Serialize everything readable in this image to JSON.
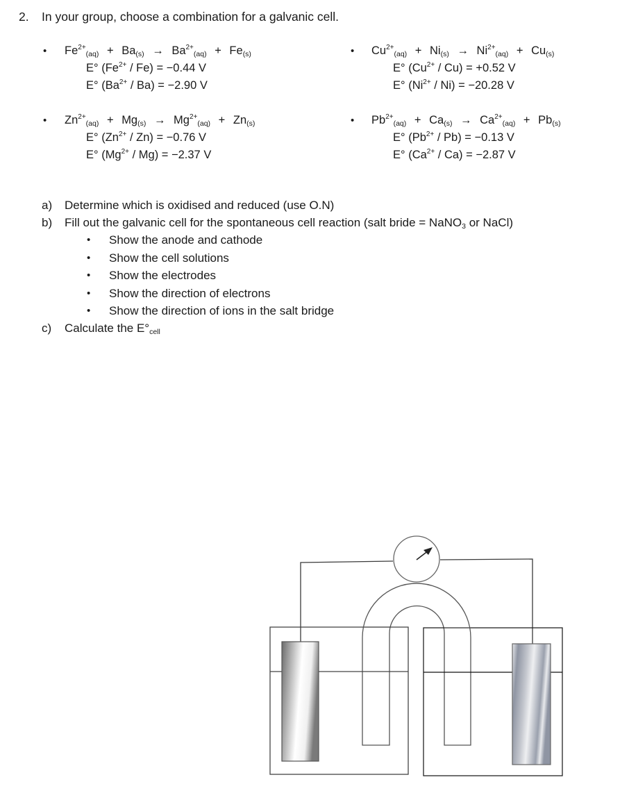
{
  "question": {
    "number": "2.",
    "prompt": "In your group, choose a combination for a galvanic cell."
  },
  "combinations": [
    {
      "reaction": {
        "r1": "Fe",
        "r1_charge": "2+",
        "r1_state": "(aq)",
        "r2": "Ba",
        "r2_state": "(s)",
        "p1": "Ba",
        "p1_charge": "2+",
        "p1_state": "(aq)",
        "p2": "Fe",
        "p2_state": "(s)",
        "plus": "+",
        "arrow": "→"
      },
      "potentials": [
        {
          "prefix": "E° (",
          "ion": "Fe",
          "charge": "2+",
          "suffix": " / Fe) = −0.44 V"
        },
        {
          "prefix": "E° (",
          "ion": "Ba",
          "charge": "2+",
          "suffix": " / Ba) = −2.90 V"
        }
      ]
    },
    {
      "reaction": {
        "r1": "Cu",
        "r1_charge": "2+",
        "r1_state": "(aq)",
        "r2": "Ni",
        "r2_state": "(s)",
        "p1": "Ni",
        "p1_charge": "2+",
        "p1_state": "(aq)",
        "p2": "Cu",
        "p2_state": "(s)",
        "plus": "+",
        "arrow": "→"
      },
      "potentials": [
        {
          "prefix": "E° (",
          "ion": "Cu",
          "charge": "2+",
          "suffix": " / Cu) = +0.52 V"
        },
        {
          "prefix": "E° (",
          "ion": "Ni",
          "charge": "2+",
          "suffix": " / Ni) = −20.28 V"
        }
      ]
    },
    {
      "reaction": {
        "r1": "Zn",
        "r1_charge": "2+",
        "r1_state": "(aq)",
        "r2": "Mg",
        "r2_state": "(s)",
        "p1": "Mg",
        "p1_charge": "2+",
        "p1_state": "(aq)",
        "p2": "Zn",
        "p2_state": "(s)",
        "plus": "+",
        "arrow": "→"
      },
      "potentials": [
        {
          "prefix": "E° (",
          "ion": "Zn",
          "charge": "2+",
          "suffix": " / Zn) = −0.76 V"
        },
        {
          "prefix": "E° (",
          "ion": "Mg",
          "charge": "2+",
          "suffix": " / Mg) = −2.37 V"
        }
      ]
    },
    {
      "reaction": {
        "r1": "Pb",
        "r1_charge": "2+",
        "r1_state": "(aq)",
        "r2": "Ca",
        "r2_state": "(s)",
        "p1": "Ca",
        "p1_charge": "2+",
        "p1_state": "(aq)",
        "p2": "Pb",
        "p2_state": "(s)",
        "plus": "+",
        "arrow": "→"
      },
      "potentials": [
        {
          "prefix": "E° (",
          "ion": "Pb",
          "charge": "2+",
          "suffix": " / Pb) = −0.13 V"
        },
        {
          "prefix": "E° (",
          "ion": "Ca",
          "charge": "2+",
          "suffix": " / Ca) = −2.87 V"
        }
      ]
    }
  ],
  "bullet_glyph": "•",
  "tasks": {
    "a": {
      "label": "a)",
      "text": "Determine which is oxidised and reduced (use O.N)"
    },
    "b": {
      "label": "b)",
      "text_before": "Fill out the galvanic cell for the spontaneous cell reaction (salt bride = NaNO",
      "text_sub": "3",
      "text_after": " or NaCl)",
      "subitems": [
        "Show the anode and cathode",
        "Show the cell solutions",
        "Show the electrodes",
        "Show the direction of electrons",
        "Show the direction of ions in the salt bridge"
      ]
    },
    "c": {
      "label": "c)",
      "text": "Calculate the E°",
      "text_sub": "cell"
    }
  },
  "diagram": {
    "meter_icon": "voltmeter-icon",
    "colors": {
      "line": "#3a3a3a",
      "left_electrode_dark": "#6b6b6b",
      "left_electrode_light": "#ffffff",
      "right_electrode_dark": "#8f95a3",
      "right_electrode_light": "#e8e9ec"
    }
  }
}
